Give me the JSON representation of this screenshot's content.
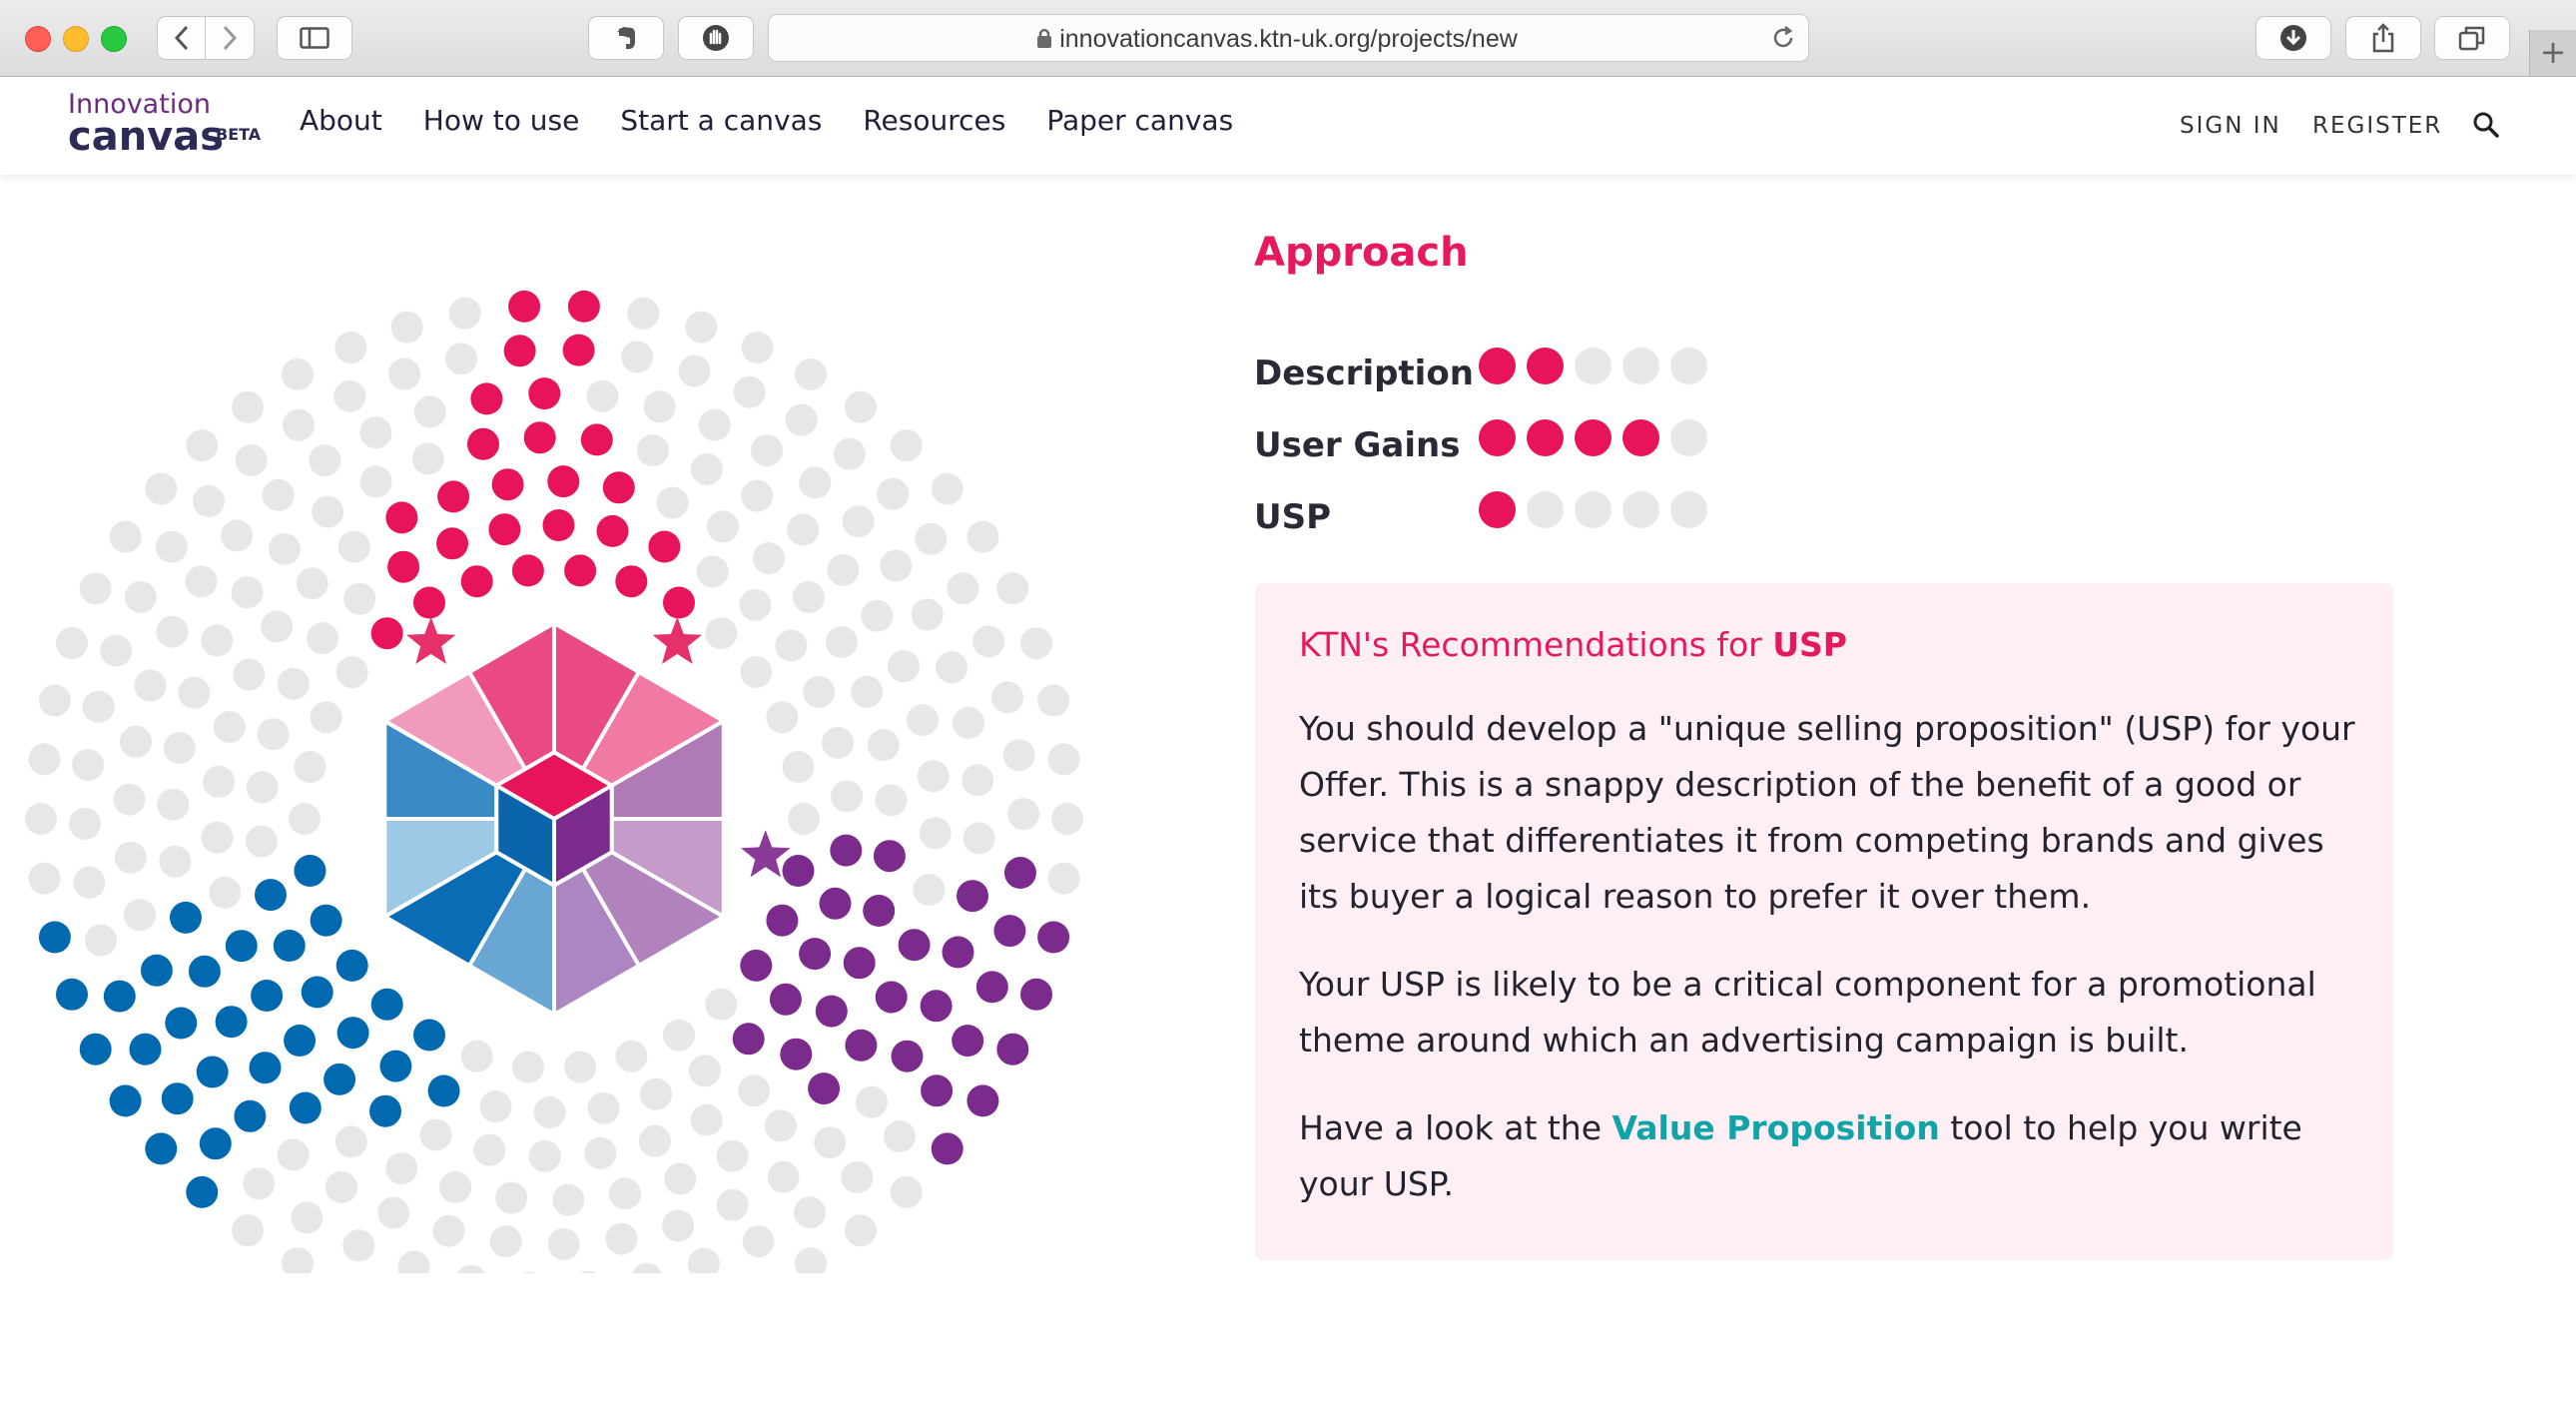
{
  "browser": {
    "url": "innovationcanvas.ktn-uk.org/projects/new"
  },
  "site": {
    "logo_line1": "Innovation",
    "logo_line2": "canvas",
    "logo_badge": "BETA",
    "nav": [
      "About",
      "How to use",
      "Start a canvas",
      "Resources",
      "Paper canvas"
    ],
    "sign_in": "SIGN IN",
    "register": "REGISTER"
  },
  "colors": {
    "accent_pink": "#e8145b",
    "accent_blue": "#0069b0",
    "accent_purple": "#7b2b8c",
    "inactive_dot": "#e7e7e7",
    "link_teal": "#10a3a8"
  },
  "section": {
    "title": "Approach",
    "ratings": [
      {
        "label": "Description",
        "value": 2,
        "max": 5
      },
      {
        "label": "User Gains",
        "value": 4,
        "max": 5
      },
      {
        "label": "USP",
        "value": 1,
        "max": 5
      }
    ]
  },
  "recommendation": {
    "title_prefix": "KTN's Recommendations for",
    "title_topic": "USP",
    "para1": "You should develop a \"unique selling proposition\" (USP) for your Offer. This is a snappy description of the benefit of a good or service that differentiates it from competing brands and gives its buyer a logical reason to prefer it over them.",
    "para2": "Your USP is likely to be a critical component for a promotional theme around which an advertising campaign is built.",
    "para3_before": "Have a look at the",
    "para3_link": "Value Proposition",
    "para3_after": "tool to help you write your USP."
  },
  "canvas_graphic": {
    "sectors": [
      {
        "name": "pink",
        "filled": [
          7,
          6,
          5,
          3,
          2,
          2,
          2
        ],
        "starred": [
          0,
          6
        ]
      },
      {
        "name": "purple",
        "filled": [
          3,
          5,
          5,
          4,
          4,
          5,
          5
        ],
        "starred": [
          0
        ]
      },
      {
        "name": "blue",
        "filled": [
          5,
          6,
          5,
          5,
          4,
          4,
          6
        ],
        "starred": []
      }
    ],
    "rings": 7
  }
}
